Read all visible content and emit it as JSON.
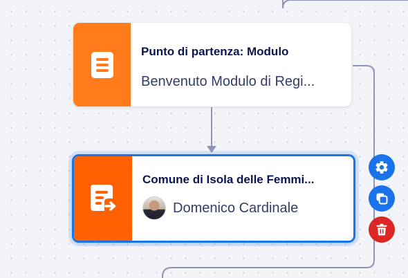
{
  "start_node": {
    "title": "Punto di partenza: Modulo",
    "subtitle": "Benvenuto Modulo di Regi...",
    "icon": "form-icon",
    "color": "#ff7b1c"
  },
  "step_node": {
    "title": "Comune di Isola delle Femmi...",
    "assignee": "Domenico Cardinale",
    "icon": "form-forward-icon",
    "color": "#ff6100",
    "selected": true
  },
  "actions": {
    "settings_icon": "gear-icon",
    "duplicate_icon": "copy-icon",
    "delete_icon": "trash-icon",
    "primary_color": "#1a73e8",
    "danger_color": "#dc2626"
  },
  "connector_color": "#8e94b8"
}
